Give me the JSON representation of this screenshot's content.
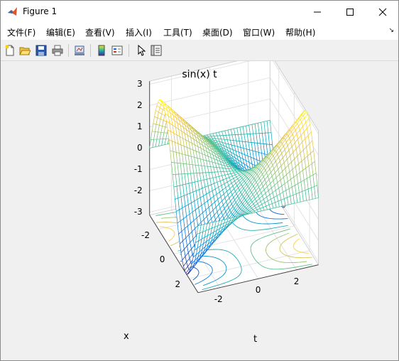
{
  "window": {
    "title": "Figure 1"
  },
  "menu": [
    {
      "label": "文件(F)"
    },
    {
      "label": "编辑(E)"
    },
    {
      "label": "查看(V)"
    },
    {
      "label": "插入(I)"
    },
    {
      "label": "工具(T)"
    },
    {
      "label": "桌面(D)"
    },
    {
      "label": "窗口(W)"
    },
    {
      "label": "帮助(H)"
    }
  ],
  "toolbar": {
    "icons": [
      "new-figure-icon",
      "open-file-icon",
      "save-icon",
      "print-icon",
      "link-plot-icon",
      "insert-colorbar-icon",
      "insert-legend-icon",
      "edit-plot-arrow-icon",
      "property-inspector-icon"
    ]
  },
  "chart_data": {
    "type": "surface-mesh-with-contour",
    "title": "sin(x) t",
    "function": "z = sin(x) * t",
    "x": {
      "label": "x",
      "range": [
        -3.1416,
        3.1416
      ],
      "ticks": [
        "-2",
        "0",
        "2"
      ]
    },
    "y": {
      "label": "t",
      "range": [
        -3.1416,
        3.1416
      ],
      "ticks": [
        "-2",
        "0",
        "2"
      ]
    },
    "z": {
      "range": [
        -3.1416,
        3.1416
      ],
      "ticks": [
        "-3",
        "-2",
        "-1",
        "0",
        "1",
        "2",
        "3"
      ]
    },
    "grid": true,
    "colormap": "parula",
    "contour": "projected onto floor",
    "mesh_points": 40
  }
}
